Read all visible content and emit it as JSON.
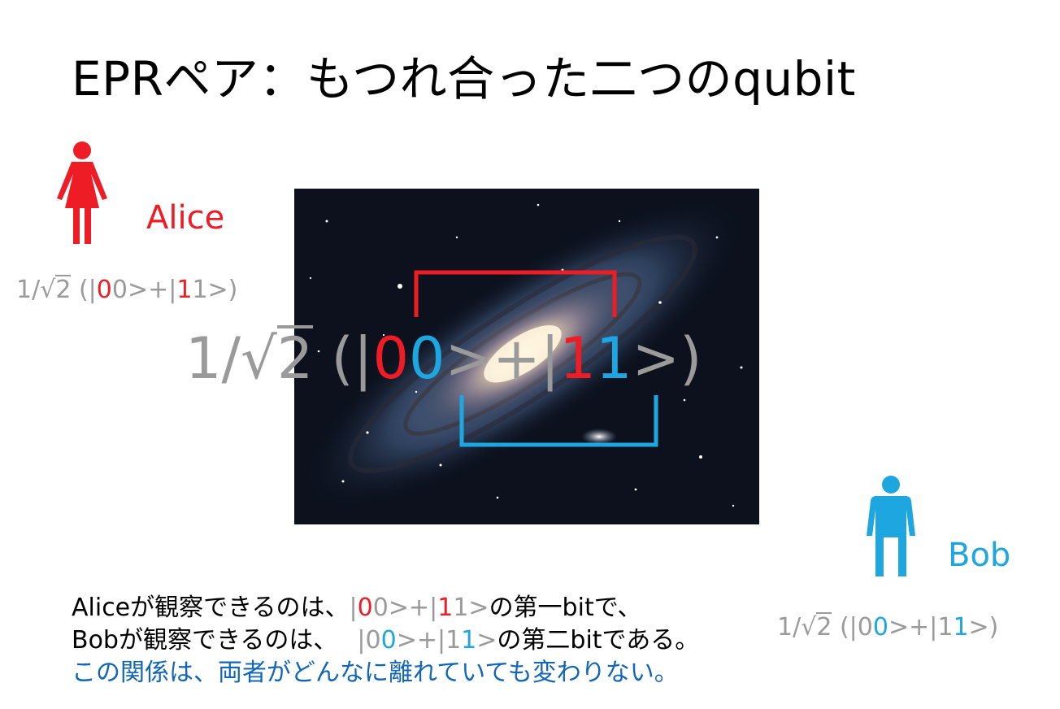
{
  "title": "EPRペア：もつれ合った二つのqubit",
  "alice": {
    "name": "Alice",
    "state": {
      "prefix": "1/",
      "radicand": "2",
      "open": " (|",
      "d1": "0",
      "d2": "0",
      "mid": ">+|",
      "d3": "1",
      "d4": "1",
      "close": ">)"
    }
  },
  "bob": {
    "name": "Bob",
    "state": {
      "prefix": "1/",
      "radicand": "2",
      "open": " (|",
      "d1": "0",
      "d2": "0",
      "mid": ">+|",
      "d3": "1",
      "d4": "1",
      "close": ">)"
    }
  },
  "center_state": {
    "prefix": "1/",
    "radicand": "2",
    "open": " (|",
    "d1": "0",
    "d2": "0",
    "mid": ">+|",
    "d3": "1",
    "d4": "1",
    "close": ">)"
  },
  "caption": {
    "line1_pre": "Aliceが観察できるのは、",
    "line1_k0": "|",
    "line1_a": "0",
    "line1_b": "0",
    "line1_mid": ">+|",
    "line1_c": "1",
    "line1_d": "1",
    "line1_post_gray": ">",
    "line1_post": "の第一bitで、",
    "line2_pre": "Bobが観察できるのは、",
    "line2_k0": "|",
    "line2_a": "0",
    "line2_b": "0",
    "line2_mid": ">+|",
    "line2_c": "1",
    "line2_d": "1",
    "line2_post_gray": ">",
    "line2_post": "の第二bitである。",
    "line3": "この関係は、両者がどんなに離れていても変わりない。"
  },
  "colors": {
    "alice": "#ee1c25",
    "bob": "#1ea6e0",
    "gray": "#9a9a9a",
    "caption_blue": "#1266b8"
  },
  "icons": {
    "alice": "woman-icon",
    "bob": "man-icon",
    "image": "galaxy-image"
  }
}
